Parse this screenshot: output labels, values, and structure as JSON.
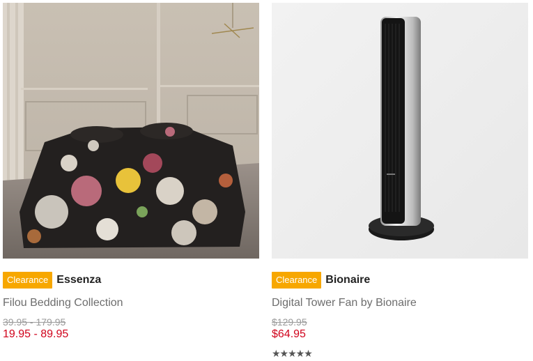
{
  "products": [
    {
      "badge": "Clearance",
      "brand": "Essenza",
      "title": "Filou Bedding Collection",
      "was_price": "39.95 - 179.95",
      "price": "19.95 - 89.95",
      "image": "floral-bedding-photo"
    },
    {
      "badge": "Clearance",
      "brand": "Bionaire",
      "title": "Digital Tower Fan by Bionaire",
      "was_price": "$129.95",
      "price": "$64.95",
      "image": "tower-fan-photo",
      "rating_stars": "★★★★★",
      "rating": 4.5
    }
  ],
  "colors": {
    "clearance_badge": "#f7a700",
    "sale_price": "#d0021b",
    "was_price": "#9a9a9a"
  }
}
